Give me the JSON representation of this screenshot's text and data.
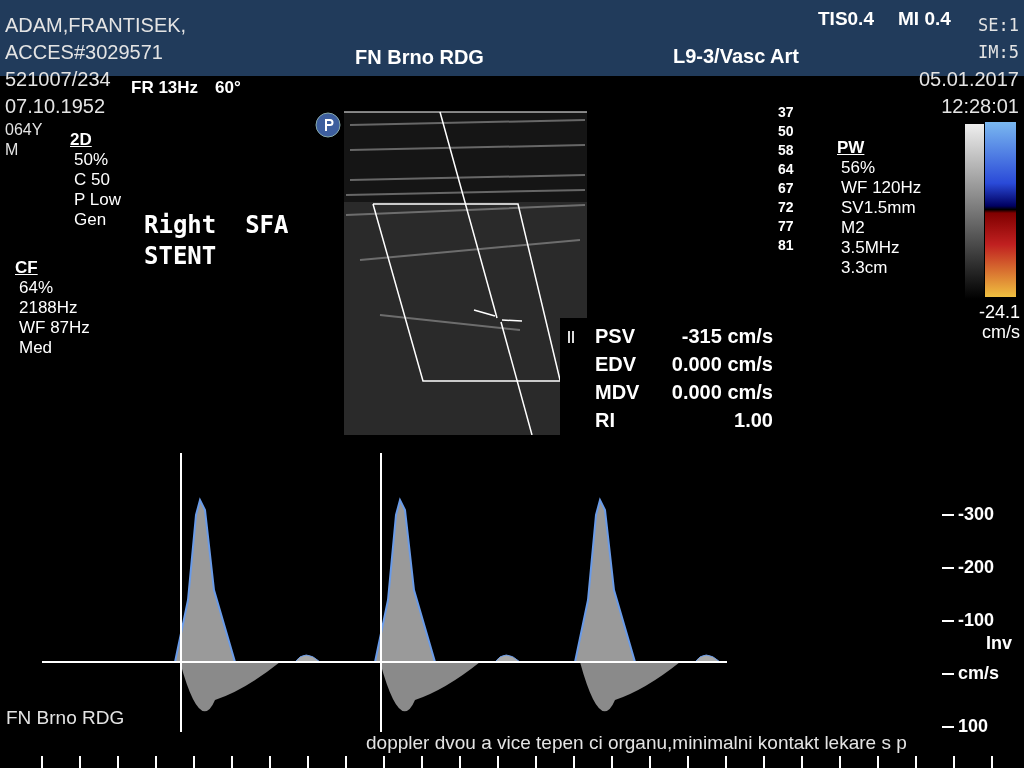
{
  "header": {
    "patient_lines": [
      "ADAM,FRANTISEK,",
      "ACCES#3029571"
    ],
    "institution": "FN Brno RDG",
    "probe": "L9-3/Vasc Art",
    "tis": "TIS0.4",
    "mi": "MI 0.4",
    "series": "SE:1",
    "image": "IM:5"
  },
  "patient_info": [
    "521007/234",
    "07.10.1952",
    "064Y",
    "M"
  ],
  "datetime": {
    "date": "05.01.2017",
    "time": "12:28:01"
  },
  "frame_rate": "FR 13Hz",
  "angle": "60°",
  "param_groups": [
    {
      "title": "2D",
      "lines": [
        "50%",
        "C 50",
        "P Low",
        "Gen"
      ]
    },
    {
      "title": "CF",
      "lines": [
        "64%",
        "2188Hz",
        "WF  87Hz",
        "Med"
      ]
    },
    {
      "title": "PW",
      "lines": [
        "56%",
        "WF 120Hz",
        "SV1.5mm",
        "M2",
        "3.5MHz",
        "3.3cm"
      ]
    }
  ],
  "annotation": [
    "Right  SFA",
    "STENT"
  ],
  "depth_numbers": [
    "37",
    "50",
    "58",
    "64",
    "67",
    "72",
    "77",
    "81"
  ],
  "color_bar": {
    "value": "-24.1",
    "unit": "cm/s"
  },
  "measurements": [
    {
      "label": "PSV",
      "value": "-315 cm/s"
    },
    {
      "label": "EDV",
      "value": "0.000 cm/s"
    },
    {
      "label": "MDV",
      "value": "0.000 cm/s"
    },
    {
      "label": "RI",
      "value": "1.00"
    }
  ],
  "velocity_scale": [
    "-300",
    "-200",
    "-100",
    "cm/s",
    "100"
  ],
  "invert": "Inv",
  "footer": {
    "institution": "FN Brno RDG",
    "ticker": "doppler dvou a vice tepen ci organu,minimalni kontakt lekare s p"
  }
}
